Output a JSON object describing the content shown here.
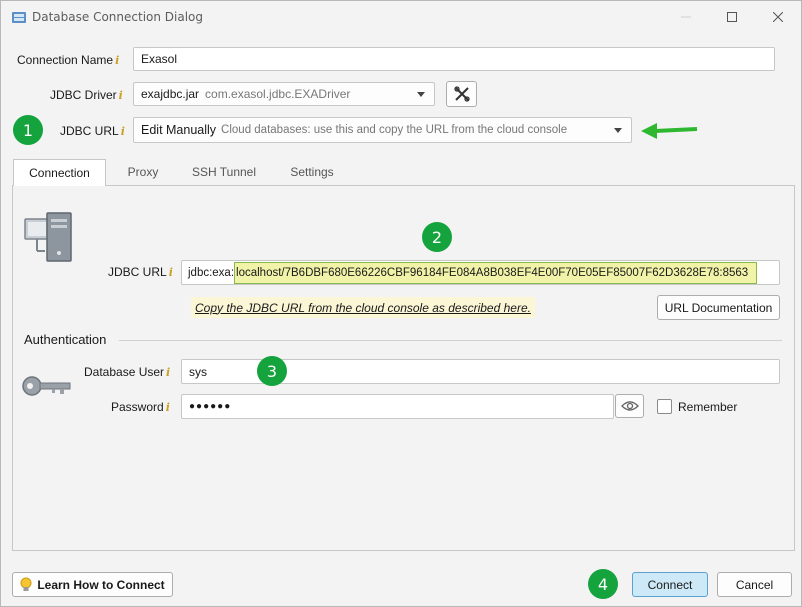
{
  "window": {
    "title": "Database Connection Dialog"
  },
  "form": {
    "connection_name_label": "Connection Name",
    "connection_name_value": "Exasol",
    "jdbc_driver_label": "JDBC Driver",
    "jdbc_driver_value": "exajdbc.jar",
    "jdbc_driver_class": "com.exasol.jdbc.EXADriver",
    "jdbc_url_mode_label": "JDBC URL",
    "jdbc_url_mode_value": "Edit Manually",
    "jdbc_url_mode_hint": "Cloud databases: use this and copy the URL from the cloud console"
  },
  "tabs": [
    {
      "label": "Connection",
      "active": true
    },
    {
      "label": "Proxy",
      "active": false
    },
    {
      "label": "SSH Tunnel",
      "active": false
    },
    {
      "label": "Settings",
      "active": false
    }
  ],
  "connection_tab": {
    "jdbc_url_label": "JDBC URL",
    "jdbc_url_prefix": "jdbc:exa:",
    "jdbc_url_rest": "localhost/7B6DBF680E66226CBF96184FE084A8B038EF4E00F70E05EF85007F62D3628E78:8563",
    "hint_link": "Copy the JDBC URL from the cloud console as described here.",
    "url_doc_button": "URL Documentation",
    "auth_section": "Authentication",
    "db_user_label": "Database User",
    "db_user_value": "sys",
    "password_label": "Password",
    "password_value": "●●●●●●",
    "remember_label": "Remember"
  },
  "footer": {
    "learn_button": "Learn How to Connect",
    "connect_button": "Connect",
    "cancel_button": "Cancel"
  },
  "annotations": {
    "badge_1": "1",
    "badge_2": "2",
    "badge_3": "3",
    "badge_4": "4"
  },
  "icons": {
    "app": "database-icon",
    "driver_settings": "tools-icon",
    "server": "server-icon",
    "key": "key-icon",
    "eye": "eye-icon",
    "bulb": "lightbulb-icon",
    "arrow": "green-arrow-icon"
  },
  "colors": {
    "badge_green": "#14a33c",
    "url_highlight": "#f1f3a8",
    "connect_button": "#cde8f6",
    "info_i": "#c9a227"
  }
}
